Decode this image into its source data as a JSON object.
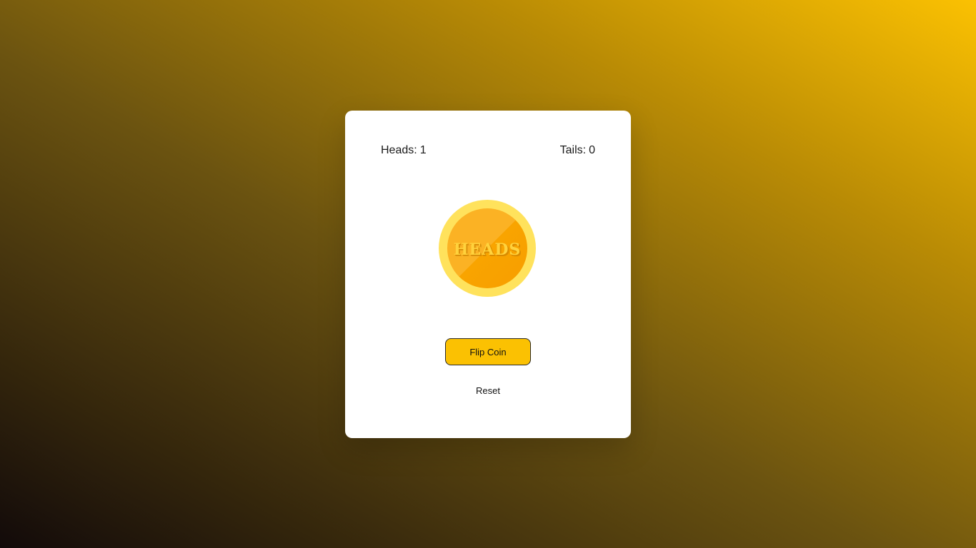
{
  "stats": {
    "heads_label": "Heads:",
    "heads_count": "1",
    "tails_label": "Tails:",
    "tails_count": "0"
  },
  "coin": {
    "face_text": "HEADS",
    "outer_color": "#ffe25c",
    "inner_color": "#fbb224"
  },
  "buttons": {
    "flip_label": "Flip Coin",
    "reset_label": "Reset"
  },
  "colors": {
    "accent": "#fbc102",
    "card_background": "#ffffff"
  }
}
